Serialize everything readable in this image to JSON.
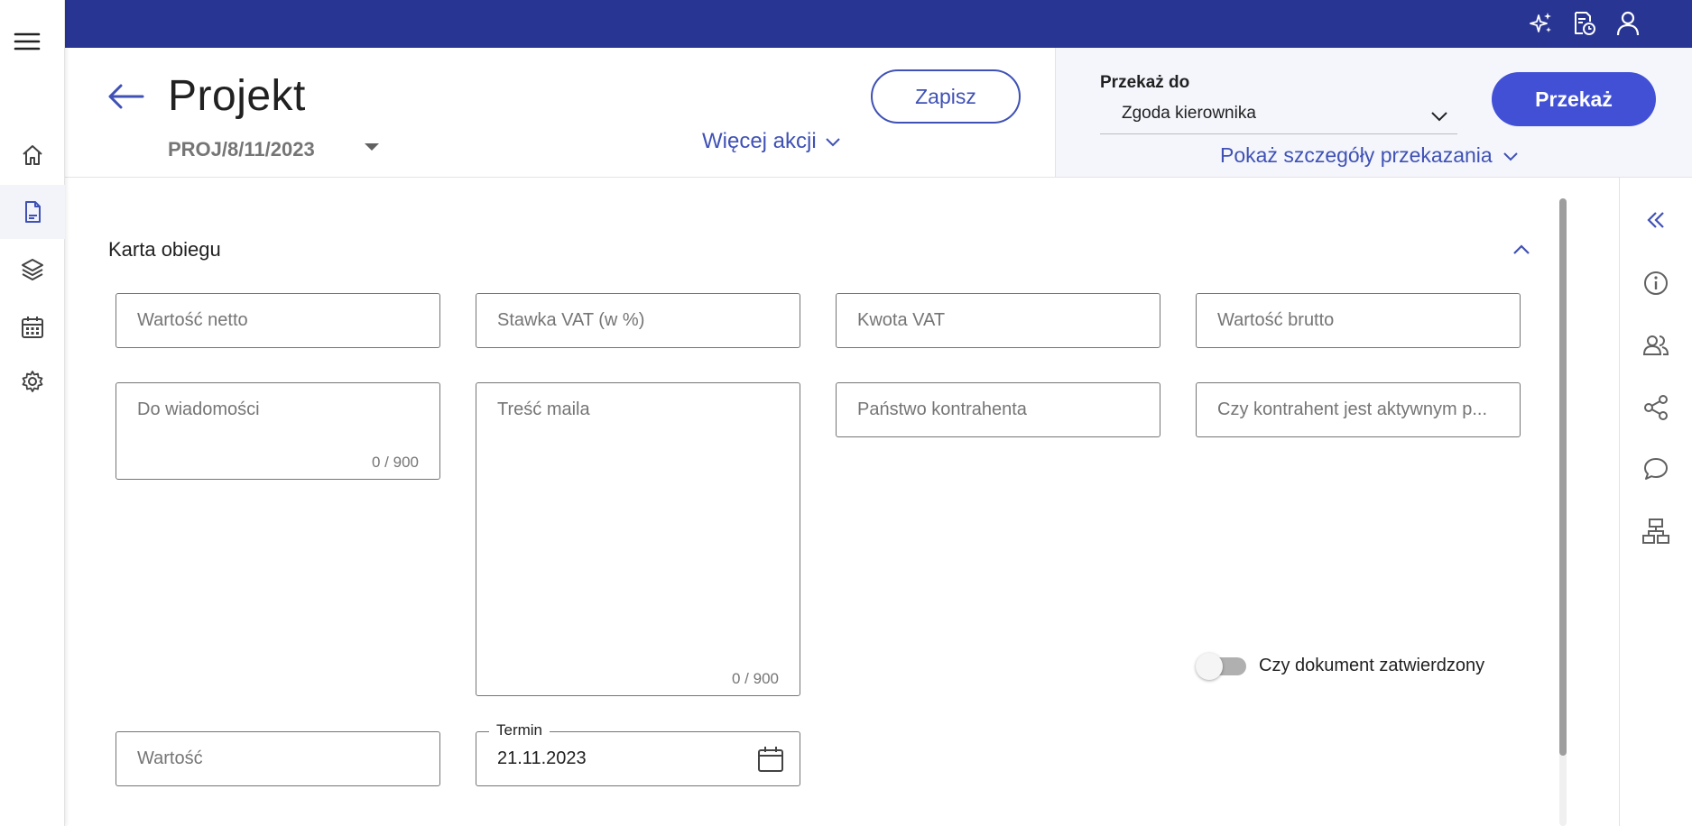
{
  "header": {
    "title": "Projekt",
    "doc_number": "PROJ/8/11/2023",
    "more_actions": "Więcej akcji",
    "save": "Zapisz"
  },
  "forward": {
    "label": "Przekaż do",
    "selected": "Zgoda kierownika",
    "button": "Przekaż",
    "details": "Pokaż szczegóły przekazania"
  },
  "section": {
    "title": "Karta obiegu"
  },
  "fields": {
    "net_value": "Wartość netto",
    "vat_rate": "Stawka VAT (w %)",
    "vat_amount": "Kwota VAT",
    "gross_value": "Wartość brutto",
    "cc": "Do wiadomości",
    "cc_counter": "0 / 900",
    "mail_body": "Treść maila",
    "mail_body_counter": "0 / 900",
    "contractor_country": "Państwo kontrahenta",
    "contractor_active": "Czy kontrahent jest aktywnym p...",
    "value": "Wartość",
    "deadline_label": "Termin",
    "deadline_value": "21.11.2023",
    "approved_label": "Czy dokument zatwierdzony"
  },
  "colors": {
    "topbar": "#283593",
    "accent": "#3f51b5",
    "primary_button": "#4250d6"
  },
  "icons": {
    "left_nav": [
      "menu-icon",
      "home-icon",
      "document-icon",
      "layers-icon",
      "calendar-icon",
      "settings-icon"
    ],
    "top_bar": [
      "sparkle-icon",
      "document-clock-icon",
      "user-icon"
    ],
    "right_rail": [
      "double-chevron-left-icon",
      "info-icon",
      "people-icon",
      "share-icon",
      "comment-icon",
      "sitemap-icon"
    ]
  }
}
